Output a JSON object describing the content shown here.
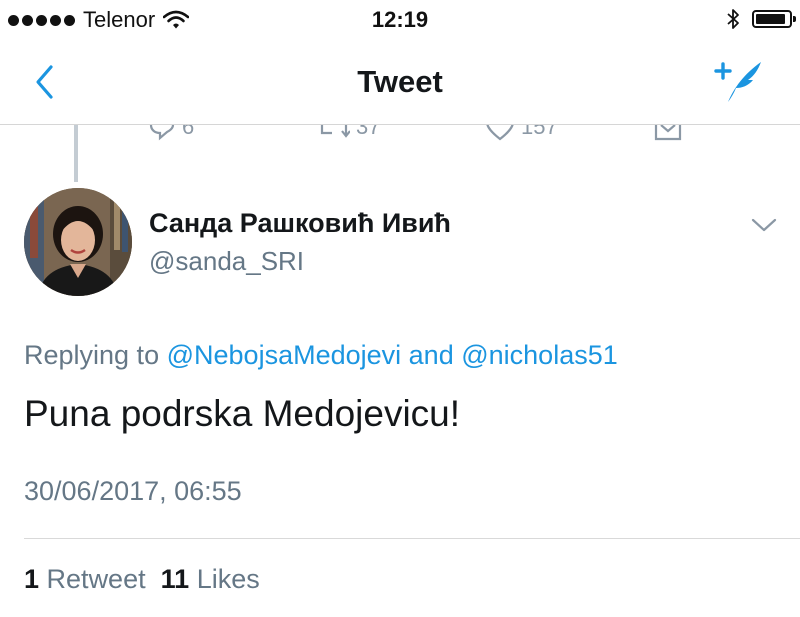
{
  "status_bar": {
    "carrier": "Telenor",
    "time": "12:19",
    "signal_icon": "signal-dots-icon",
    "wifi_icon": "wifi-icon",
    "bluetooth_icon": "bluetooth-icon",
    "battery_level": 0.9
  },
  "nav": {
    "title": "Tweet",
    "back_icon": "chevron-left-icon",
    "compose_icon": "compose-tweet-icon",
    "accent": "#1b95e0"
  },
  "previous_tweet_actions": {
    "reply_count": "6",
    "retweet_count": "37",
    "like_count": "157"
  },
  "tweet": {
    "author_name": "Санда Рашковић Ивић",
    "author_handle": "@sanda_SRI",
    "replying_prefix": "Replying to",
    "mention_1": "@NebojsaMedojevi",
    "mention_joiner": "and",
    "mention_2": "@nicholas51",
    "text": "Puna podrska Medojevicu!",
    "timestamp": "30/06/2017, 06:55",
    "retweets_count": "1",
    "retweets_label": "Retweet",
    "likes_count": "11",
    "likes_label": "Likes"
  }
}
